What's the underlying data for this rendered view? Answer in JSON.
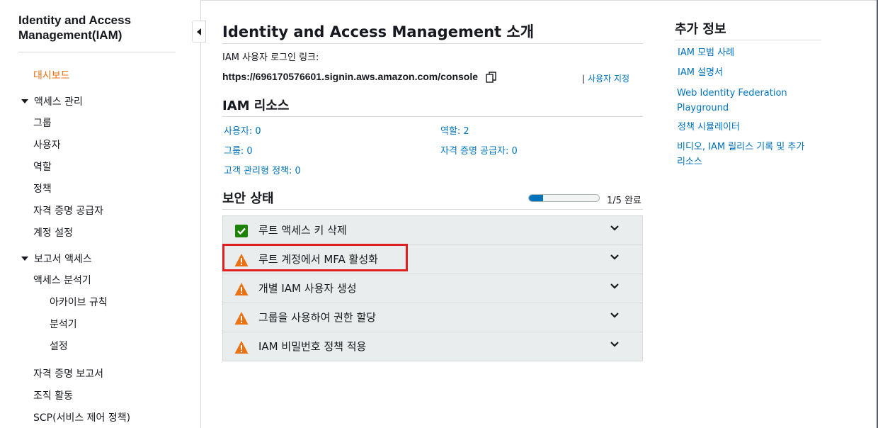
{
  "sidebar": {
    "title": "Identity and Access Management(IAM)",
    "dashboard": "대시보드",
    "access_mgmt": {
      "label": "액세스 관리",
      "items": [
        "그룹",
        "사용자",
        "역할",
        "정책",
        "자격 증명 공급자",
        "계정 설정"
      ]
    },
    "reports": {
      "label": "보고서 액세스",
      "analyzer": "액세스 분석기",
      "analyzer_items": [
        "아카이브 규칙",
        "분석기",
        "설정"
      ],
      "items": [
        "자격 증명 보고서",
        "조직 활동",
        "SCP(서비스 제어 정책)"
      ]
    }
  },
  "main": {
    "title": "Identity and Access Management 소개",
    "signin_label": "IAM 사용자 로그인 링크:",
    "signin_url": "https://696170576601.signin.aws.amazon.com/console",
    "customize_link": "사용자 지정",
    "resources_title": "IAM 리소스",
    "resources": {
      "users": "사용자: 0",
      "roles": "역할: 2",
      "groups": "그룹: 0",
      "identity_providers": "자격 증명 공급자: 0",
      "customer_policies": "고객 관리형 정책: 0"
    },
    "security_title": "보안 상태",
    "progress_text": "1/5 완료",
    "progress_fraction": 0.2,
    "security_items": [
      {
        "label": "루트 액세스 키 삭제",
        "status": "complete"
      },
      {
        "label": "루트 계정에서 MFA 활성화",
        "status": "warning"
      },
      {
        "label": "개별 IAM 사용자 생성",
        "status": "warning"
      },
      {
        "label": "그룹을 사용하여 권한 할당",
        "status": "warning"
      },
      {
        "label": "IAM 비밀번호 정책 적용",
        "status": "warning"
      }
    ]
  },
  "info": {
    "title": "추가 정보",
    "links": [
      "IAM 모범 사례",
      "IAM 설명서",
      "Web Identity Federation Playground",
      "정책 시뮬레이터",
      "비디오, IAM 릴리스 기록 및 추가 리소스"
    ]
  },
  "colors": {
    "link": "#0073bb",
    "active": "#ec7211",
    "success": "#1d8102",
    "warning": "#ec7211",
    "highlight": "#e02020"
  }
}
